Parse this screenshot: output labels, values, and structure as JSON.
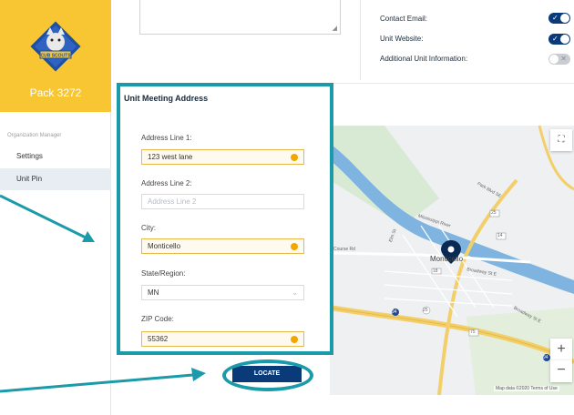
{
  "sidebar": {
    "pack_name": "Pack 3272",
    "org_label": "Organization Manager",
    "items": [
      {
        "label": "Settings"
      },
      {
        "label": "Unit Pin"
      }
    ]
  },
  "top_options": [
    {
      "label": "Contact Email:",
      "enabled": true
    },
    {
      "label": "Unit Website:",
      "enabled": true
    },
    {
      "label": "Additional Unit Information:",
      "enabled": false
    }
  ],
  "address_panel": {
    "title": "Unit Meeting Address",
    "address1": {
      "label": "Address Line 1:",
      "value": "123 west lane"
    },
    "address2": {
      "label": "Address Line 2:",
      "placeholder": "Address Line 2"
    },
    "city": {
      "label": "City:",
      "value": "Monticello"
    },
    "state": {
      "label": "State/Region:",
      "value": "MN"
    },
    "zip": {
      "label": "ZIP Code:",
      "value": "55362"
    }
  },
  "map": {
    "town": "Monticello",
    "attribution": "Map data ©2020   Terms of Use",
    "labels": [
      "Course Rd",
      "Mississippi River",
      "Broadway St E",
      "Park Blvd SE",
      "Elm St",
      "Broadway St E"
    ],
    "shields": [
      "25",
      "14",
      "75",
      "25",
      "94",
      "94",
      "18"
    ]
  },
  "locate_button": {
    "label": "LOCATE"
  },
  "colors": {
    "accent": "#1b9aa9",
    "brand": "#0a3a78",
    "logo_bg": "#f8c633"
  }
}
